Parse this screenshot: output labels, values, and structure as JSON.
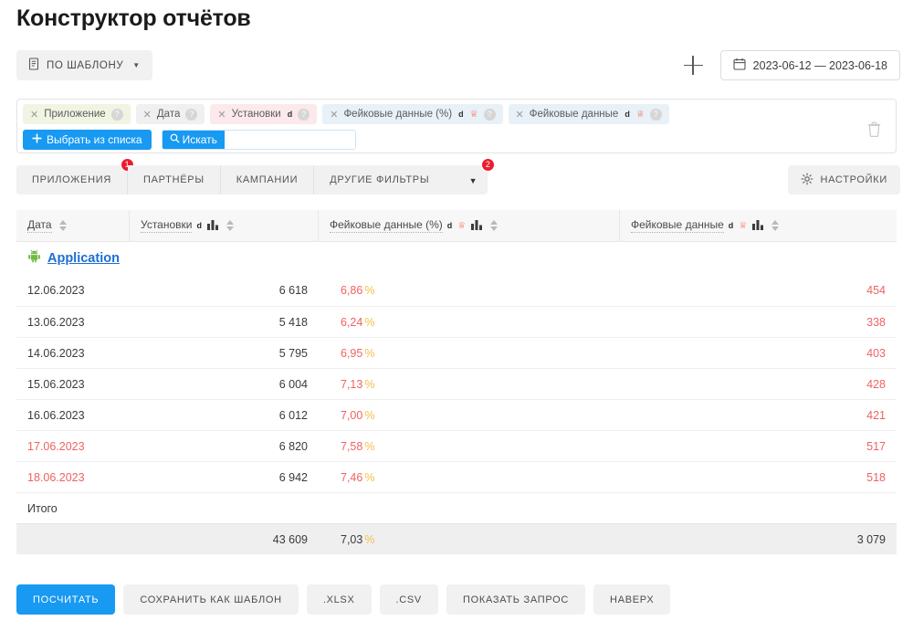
{
  "page_title": "Конструктор отчётов",
  "toolbar": {
    "template_button": "ПО ШАБЛОНУ",
    "template_icon": "document-icon",
    "add_icon": "plus-icon",
    "date_range": "2023-06-12 — 2023-06-18",
    "calendar_icon": "calendar-icon"
  },
  "filters": {
    "chips": [
      {
        "label": "Приложение",
        "style": "app",
        "sup": "",
        "crown": false
      },
      {
        "label": "Дата",
        "style": "date",
        "sup": "",
        "crown": false
      },
      {
        "label": "Установки",
        "style": "inst",
        "sup": "d",
        "crown": false
      },
      {
        "label": "Фейковые данные (%)",
        "style": "fake",
        "sup": "d",
        "crown": true
      },
      {
        "label": "Фейковые данные",
        "style": "fake",
        "sup": "d",
        "crown": true
      }
    ],
    "pick_button": "Выбрать из списка",
    "search_button": "Искать",
    "search_value": "",
    "search_placeholder": "",
    "delete_icon": "trash-icon"
  },
  "tabs": [
    {
      "label": "ПРИЛОЖЕНИЯ",
      "badge": "1"
    },
    {
      "label": "ПАРТНЁРЫ",
      "badge": ""
    },
    {
      "label": "КАМПАНИИ",
      "badge": ""
    },
    {
      "label": "ДРУГИЕ ФИЛЬТРЫ",
      "badge": "2"
    }
  ],
  "settings_button": "НАСТРОЙКИ",
  "table": {
    "columns": [
      {
        "label": "Дата",
        "sup": "",
        "crown": false,
        "chart_icon": false
      },
      {
        "label": "Установки",
        "sup": "d",
        "crown": false,
        "chart_icon": true
      },
      {
        "label": "Фейковые данные (%)",
        "sup": "d",
        "crown": true,
        "chart_icon": true
      },
      {
        "label": "Фейковые данные",
        "sup": "d",
        "crown": true,
        "chart_icon": true
      }
    ],
    "group": {
      "icon": "android-icon",
      "label": "Application"
    },
    "rows": [
      {
        "date": "12.06.2023",
        "weekend": false,
        "installs": "6 618",
        "fake_pct": "6,86",
        "fake_abs": "454"
      },
      {
        "date": "13.06.2023",
        "weekend": false,
        "installs": "5 418",
        "fake_pct": "6,24",
        "fake_abs": "338"
      },
      {
        "date": "14.06.2023",
        "weekend": false,
        "installs": "5 795",
        "fake_pct": "6,95",
        "fake_abs": "403"
      },
      {
        "date": "15.06.2023",
        "weekend": false,
        "installs": "6 004",
        "fake_pct": "7,13",
        "fake_abs": "428"
      },
      {
        "date": "16.06.2023",
        "weekend": false,
        "installs": "6 012",
        "fake_pct": "7,00",
        "fake_abs": "421"
      },
      {
        "date": "17.06.2023",
        "weekend": true,
        "installs": "6 820",
        "fake_pct": "7,58",
        "fake_abs": "517"
      },
      {
        "date": "18.06.2023",
        "weekend": true,
        "installs": "6 942",
        "fake_pct": "7,46",
        "fake_abs": "518"
      }
    ],
    "totals_label": "Итого",
    "totals": {
      "installs": "43 609",
      "fake_pct": "7,03",
      "fake_abs": "3 079"
    },
    "percent_sign": "%"
  },
  "bottom_buttons": [
    {
      "label": "ПОСЧИТАТЬ",
      "primary": true
    },
    {
      "label": "СОХРАНИТЬ КАК ШАБЛОН",
      "primary": false
    },
    {
      "label": ".XLSX",
      "primary": false
    },
    {
      "label": ".CSV",
      "primary": false
    },
    {
      "label": "ПОКАЗАТЬ ЗАПРОС",
      "primary": false
    },
    {
      "label": "НАВЕРХ",
      "primary": false
    }
  ],
  "colors": {
    "accent_blue": "#1899f2",
    "link_blue": "#1a6fd4",
    "badge_red": "#ec1c2e",
    "value_red": "#f06262",
    "percent_yellow": "#f2c14a",
    "crown_orange": "#ff6a55",
    "android_green": "#73b944"
  }
}
